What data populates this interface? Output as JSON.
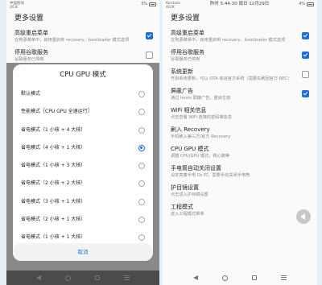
{
  "left": {
    "status": {
      "carrier": "中国移动",
      "speed": "26 K",
      "time_text": "晚上 1:09 | 5\n星期六 1 月 6 日",
      "battery": "3%"
    },
    "title": "更多设置",
    "items": [
      {
        "title": "高级重启菜单",
        "subtitle": "在电源菜单中，启用重启到 recovery、bootloader 模式选项",
        "checked": true
      },
      {
        "title": "停用谷歌服务",
        "subtitle": "谷歌服务已停用",
        "checked": false
      }
    ],
    "dialog": {
      "title": "CPU GPU 模式",
      "options": [
        {
          "label": "默认模式",
          "selected": false
        },
        {
          "label": "性能模式［CPU GPU 全速运行］",
          "selected": false
        },
        {
          "label": "省电模式（1 小核 + 4 大核）",
          "selected": false
        },
        {
          "label": "省电模式（4 小核 + 1 大核）",
          "selected": true
        },
        {
          "label": "省电模式（1 小核 + 3 大核）",
          "selected": false
        },
        {
          "label": "省电模式（2 小核 + 2 大核）",
          "selected": false
        },
        {
          "label": "省电模式（3 小核 + 1 大核）",
          "selected": false
        },
        {
          "label": "省电模式（2 小核 + 1 大核）",
          "selected": false
        },
        {
          "label": "省电模式（1 小核 + 1 大核）",
          "selected": false
        }
      ],
      "cancel": "取消"
    }
  },
  "right": {
    "status": {
      "carrier": "Kerdaze",
      "speed": "4G/K",
      "center": "昨时 5:44:30 周日 12月29日",
      "battery": "4%"
    },
    "title": "更多设置",
    "items": [
      {
        "title": "高级重启菜单",
        "subtitle": "在电源菜单中，启用重启到 recovery、bootloader 模式选项",
        "checkbox": "on"
      },
      {
        "title": "停用谷歌服务",
        "subtitle": "谷歌服务已停用",
        "checkbox": "on"
      },
      {
        "title": "系统更新",
        "subtitle": "开启系统更新，可以 OTA 收敛官方系统（需要先刷回官方 REC）",
        "checkbox": "off"
      },
      {
        "title": "屏蔽广告",
        "subtitle": "通过 hosts 屏蔽广告，重启生效",
        "checkbox": "on"
      },
      {
        "title": "WiFi 相关信息",
        "subtitle": "点击查看 WiFi 连接的密码等信息",
        "checkbox": "none"
      },
      {
        "title": "刷入 Recovery",
        "subtitle": "手机刷入第三方/官方 Recovery",
        "checkbox": "none"
      },
      {
        "title": "CPU GPU 模式",
        "subtitle": "调整 CPU/GPU 模式，核心数等",
        "checkbox": "none"
      },
      {
        "title": "手电筒自动关闭设置",
        "subtitle": "设定亮着手电 Ds 时，需要手动关闭手电筒",
        "checkbox": "none"
      },
      {
        "title": "护目镜设置",
        "subtitle": "点击进入护目镜设置",
        "checkbox": "none"
      },
      {
        "title": "工程模式",
        "subtitle": "进入工程模式菜单",
        "checkbox": "none"
      }
    ]
  }
}
